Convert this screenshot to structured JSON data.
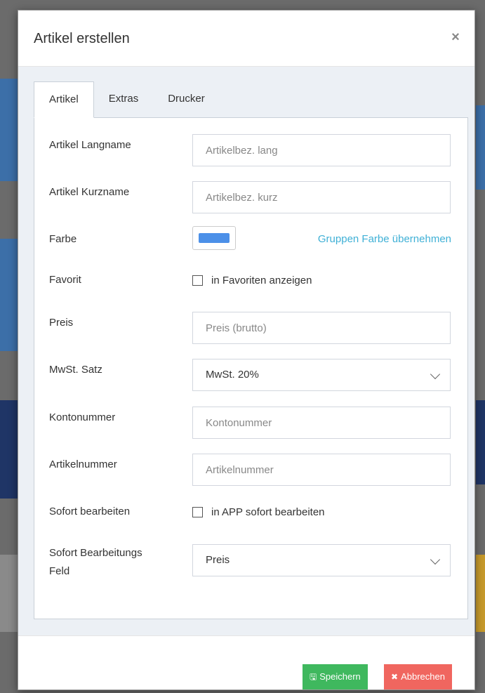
{
  "modal": {
    "title": "Artikel erstellen",
    "close_label": "×"
  },
  "tabs": [
    {
      "label": "Artikel",
      "active": true
    },
    {
      "label": "Extras",
      "active": false
    },
    {
      "label": "Drucker",
      "active": false
    }
  ],
  "form": {
    "langname": {
      "label": "Artikel Langname",
      "placeholder": "Artikelbez. lang",
      "value": ""
    },
    "kurzname": {
      "label": "Artikel Kurzname",
      "placeholder": "Artikelbez. kurz",
      "value": ""
    },
    "farbe": {
      "label": "Farbe",
      "color": "#4c90e8",
      "link": "Gruppen Farbe übernehmen"
    },
    "favorit": {
      "label": "Favorit",
      "checkbox_label": "in Favoriten anzeigen",
      "checked": false
    },
    "preis": {
      "label": "Preis",
      "placeholder": "Preis (brutto)",
      "value": ""
    },
    "mwst": {
      "label": "MwSt. Satz",
      "selected": "MwSt. 20%"
    },
    "kontonummer": {
      "label": "Kontonummer",
      "placeholder": "Kontonummer",
      "value": ""
    },
    "artikelnummer": {
      "label": "Artikelnummer",
      "placeholder": "Artikelnummer",
      "value": ""
    },
    "sofort": {
      "label": "Sofort bearbeiten",
      "checkbox_label": "in APP sofort bearbeiten",
      "checked": false
    },
    "sofort_feld": {
      "label_line1": "Sofort Bearbeitungs",
      "label_line2": "Feld",
      "selected": "Preis"
    }
  },
  "footer": {
    "save_label": "Speichern",
    "cancel_label": "Abbrechen"
  },
  "colors": {
    "save": "#3fb85e",
    "cancel": "#f0665f",
    "link": "#3fb0d6",
    "body_bg": "#ecf0f5"
  }
}
